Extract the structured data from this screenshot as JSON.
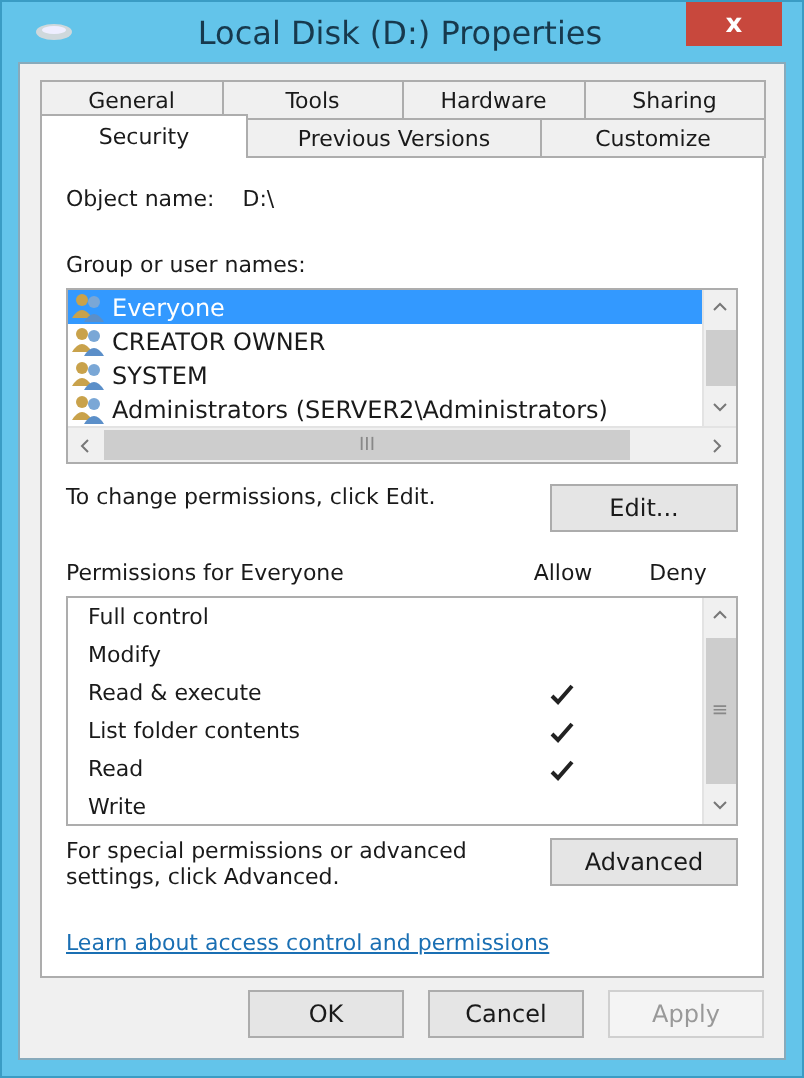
{
  "window": {
    "title": "Local Disk (D:) Properties",
    "close": "x"
  },
  "tab_rows": [
    [
      {
        "label": "General",
        "selected": false
      },
      {
        "label": "Tools",
        "selected": false
      },
      {
        "label": "Hardware",
        "selected": false
      },
      {
        "label": "Sharing",
        "selected": false
      }
    ],
    [
      {
        "label": "Security",
        "selected": true
      },
      {
        "label": "Previous Versions",
        "selected": false
      },
      {
        "label": "Customize",
        "selected": false
      }
    ]
  ],
  "object_name": {
    "label": "Object name:",
    "value": "D:\\"
  },
  "groups": {
    "label": "Group or user names:",
    "items": [
      {
        "name": "Everyone",
        "selected": true
      },
      {
        "name": "CREATOR OWNER",
        "selected": false
      },
      {
        "name": "SYSTEM",
        "selected": false
      },
      {
        "name": "Administrators (SERVER2\\Administrators)",
        "selected": false
      }
    ],
    "scroll_grip": "III"
  },
  "edit_hint": "To change permissions, click Edit.",
  "edit_button": "Edit...",
  "permissions": {
    "label": "Permissions for Everyone",
    "allow_heading": "Allow",
    "deny_heading": "Deny",
    "rows": [
      {
        "name": "Full control",
        "allow": false
      },
      {
        "name": "Modify",
        "allow": false
      },
      {
        "name": "Read & execute",
        "allow": true
      },
      {
        "name": "List folder contents",
        "allow": true
      },
      {
        "name": "Read",
        "allow": true
      },
      {
        "name": "Write",
        "allow": false
      }
    ],
    "scroll_grip": "≡"
  },
  "advanced_hint": "For special permissions or advanced settings, click Advanced.",
  "advanced_button": "Advanced",
  "learn_link": "Learn about access control and permissions",
  "buttons": [
    {
      "label": "OK",
      "disabled": false
    },
    {
      "label": "Cancel",
      "disabled": false
    },
    {
      "label": "Apply",
      "disabled": true
    }
  ]
}
